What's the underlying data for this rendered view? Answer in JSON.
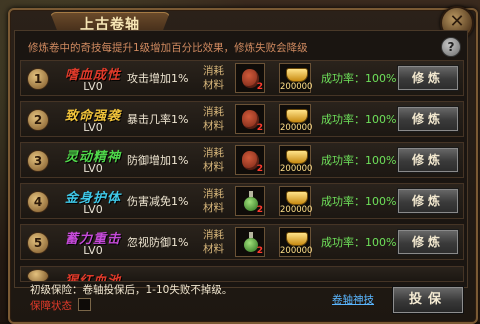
{
  "window": {
    "title": "上古卷轴",
    "close_label": "✕",
    "help_label": "?"
  },
  "info_text": "修炼卷中的奇技每提升1级增加百分比效果，修炼失败会降级",
  "skills": [
    {
      "index": "1",
      "name": "嗜血成性",
      "name_color": "#e03a2a",
      "level": "LV0",
      "effect": "攻击增加1%",
      "cost_label_1": "消耗",
      "cost_label_2": "材料",
      "material_icon": "heart-material-icon",
      "material_qty": "2",
      "gold_qty": "200000",
      "success_rate": "成功率：100%",
      "button": "修炼"
    },
    {
      "index": "2",
      "name": "致命强袭",
      "name_color": "#f0c23a",
      "level": "LV0",
      "effect": "暴击几率1%",
      "cost_label_1": "消耗",
      "cost_label_2": "材料",
      "material_icon": "heart-material-icon",
      "material_qty": "2",
      "gold_qty": "200000",
      "success_rate": "成功率：100%",
      "button": "修炼"
    },
    {
      "index": "3",
      "name": "灵动精神",
      "name_color": "#4fd64a",
      "level": "LV0",
      "effect": "防御增加1%",
      "cost_label_1": "消耗",
      "cost_label_2": "材料",
      "material_icon": "heart-material-icon",
      "material_qty": "2",
      "gold_qty": "200000",
      "success_rate": "成功率：100%",
      "button": "修炼"
    },
    {
      "index": "4",
      "name": "金身护体",
      "name_color": "#3fc8e8",
      "level": "LV0",
      "effect": "伤害减免1%",
      "cost_label_1": "消耗",
      "cost_label_2": "材料",
      "material_icon": "potion-material-icon",
      "material_qty": "2",
      "gold_qty": "200000",
      "success_rate": "成功率：100%",
      "button": "修炼"
    },
    {
      "index": "5",
      "name": "蓄力重击",
      "name_color": "#c54ad8",
      "level": "LV0",
      "effect": "忽视防御1%",
      "cost_label_1": "消耗",
      "cost_label_2": "材料",
      "material_icon": "potion-material-icon",
      "material_qty": "2",
      "gold_qty": "200000",
      "success_rate": "成功率：100%",
      "button": "修炼"
    }
  ],
  "partial_row": {
    "name": "猩红血池",
    "name_color": "#e03a2a"
  },
  "footer": {
    "basic_protection": "初级保险：卷轴投保后，1-10失败不掉级。",
    "protection_status": "保障状态",
    "divine_link": "卷轴神技",
    "insure_button": "投保"
  }
}
